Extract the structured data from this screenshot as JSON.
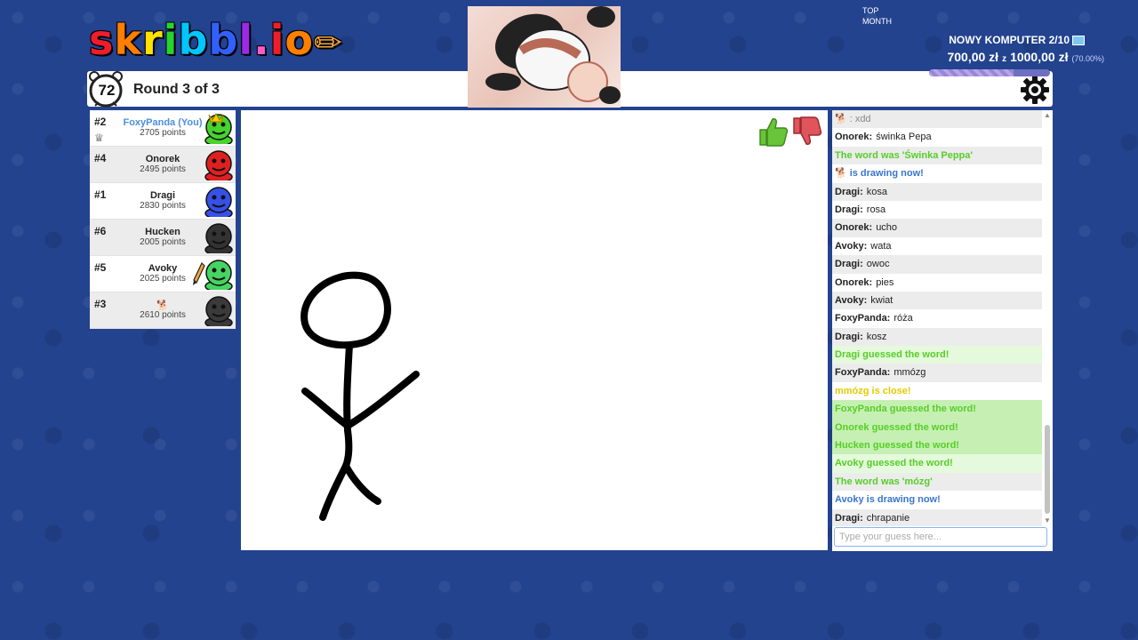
{
  "header": {
    "logo_letters": [
      {
        "char": "s",
        "color": "#ef1d2b"
      },
      {
        "char": "k",
        "color": "#ff7f00"
      },
      {
        "char": "r",
        "color": "#ffe000"
      },
      {
        "char": "i",
        "color": "#29d32d"
      },
      {
        "char": "b",
        "color": "#00c6ff"
      },
      {
        "char": "b",
        "color": "#3260ff"
      },
      {
        "char": "l",
        "color": "#9d29e2"
      },
      {
        "char": ".",
        "color": "#ff5acb"
      },
      {
        "char": "i",
        "color": "#ef1d2b"
      },
      {
        "char": "o",
        "color": "#ff7f00"
      }
    ],
    "timer": "72",
    "round_text": "Round 3 of 3"
  },
  "stream": {
    "top_label": "TOP",
    "month_label": "MONTH",
    "goal_title": "NOWY KOMPUTER 2/10",
    "goal_current": "700,00 zł",
    "goal_separator": "z",
    "goal_target": "1000,00 zł",
    "goal_percent_text": "(70.00%)",
    "goal_progress": 0.7
  },
  "players": [
    {
      "rank": "#2",
      "name": "FoxyPanda (You)",
      "points": "2705 points",
      "avatar_color": "#46d42e",
      "is_self": true,
      "owner": true,
      "crown": true,
      "drawing": false
    },
    {
      "rank": "#4",
      "name": "Onorek",
      "points": "2495 points",
      "avatar_color": "#e02020",
      "is_self": false,
      "owner": false,
      "crown": false,
      "drawing": false
    },
    {
      "rank": "#1",
      "name": "Dragi",
      "points": "2830 points",
      "avatar_color": "#3650e8",
      "is_self": false,
      "owner": false,
      "crown": false,
      "drawing": false
    },
    {
      "rank": "#6",
      "name": "Hucken",
      "points": "2005 points",
      "avatar_color": "#333333",
      "is_self": false,
      "owner": false,
      "crown": false,
      "drawing": false
    },
    {
      "rank": "#5",
      "name": "Avoky",
      "points": "2025 points",
      "avatar_color": "#46d462",
      "is_self": false,
      "owner": false,
      "crown": false,
      "drawing": true
    },
    {
      "rank": "#3",
      "name": "🐕",
      "points": "2610 points",
      "avatar_color": "#3a3a3a",
      "is_self": false,
      "owner": false,
      "crown": false,
      "drawing": false
    }
  ],
  "speech_bubble": "chrapanie",
  "chat": {
    "messages": [
      {
        "kind": "normal",
        "icon": "🐕",
        "author": "",
        "text": ": xdd",
        "muted": true
      },
      {
        "kind": "normal",
        "author": "Onorek:",
        "text": "świnka Pepa"
      },
      {
        "kind": "word",
        "text": "The word was 'Świnka Peppa'"
      },
      {
        "kind": "drawing",
        "icon": "🐕",
        "text": "is drawing now!"
      },
      {
        "kind": "normal",
        "author": "Dragi:",
        "text": "kosa"
      },
      {
        "kind": "normal",
        "author": "Dragi:",
        "text": "rosa"
      },
      {
        "kind": "normal",
        "author": "Onorek:",
        "text": "ucho"
      },
      {
        "kind": "normal",
        "author": "Avoky:",
        "text": "wata"
      },
      {
        "kind": "normal",
        "author": "Dragi:",
        "text": "owoc"
      },
      {
        "kind": "normal",
        "author": "Onorek:",
        "text": "pies"
      },
      {
        "kind": "normal",
        "author": "Avoky:",
        "text": "kwiat"
      },
      {
        "kind": "normal",
        "author": "FoxyPanda:",
        "text": "róża"
      },
      {
        "kind": "normal",
        "author": "Dragi:",
        "text": "kosz"
      },
      {
        "kind": "guessed",
        "text": "Dragi guessed the word!"
      },
      {
        "kind": "normal",
        "author": "FoxyPanda:",
        "text": "mmózg"
      },
      {
        "kind": "close",
        "text": "mmózg is close!"
      },
      {
        "kind": "guessed",
        "hl": true,
        "text": "FoxyPanda guessed the word!"
      },
      {
        "kind": "guessed",
        "hl": true,
        "text": "Onorek guessed the word!"
      },
      {
        "kind": "guessed",
        "hl": true,
        "text": "Hucken guessed the word!"
      },
      {
        "kind": "guessed",
        "text": "Avoky guessed the word!"
      },
      {
        "kind": "word",
        "text": "The word was 'mózg'"
      },
      {
        "kind": "drawing",
        "text": "Avoky is drawing now!"
      },
      {
        "kind": "normal",
        "author": "Dragi:",
        "text": "chrapanie"
      }
    ],
    "input_placeholder": "Type your guess here..."
  },
  "colors": {
    "background": "#23438f",
    "guessed_green": "#56ce27",
    "drawing_blue": "#3975ce",
    "close_yellow": "#e2cb00",
    "self_name_blue": "#4a8fe0",
    "thumbs_up_green": "#6ac43a",
    "thumbs_down_red": "#e0545c"
  }
}
